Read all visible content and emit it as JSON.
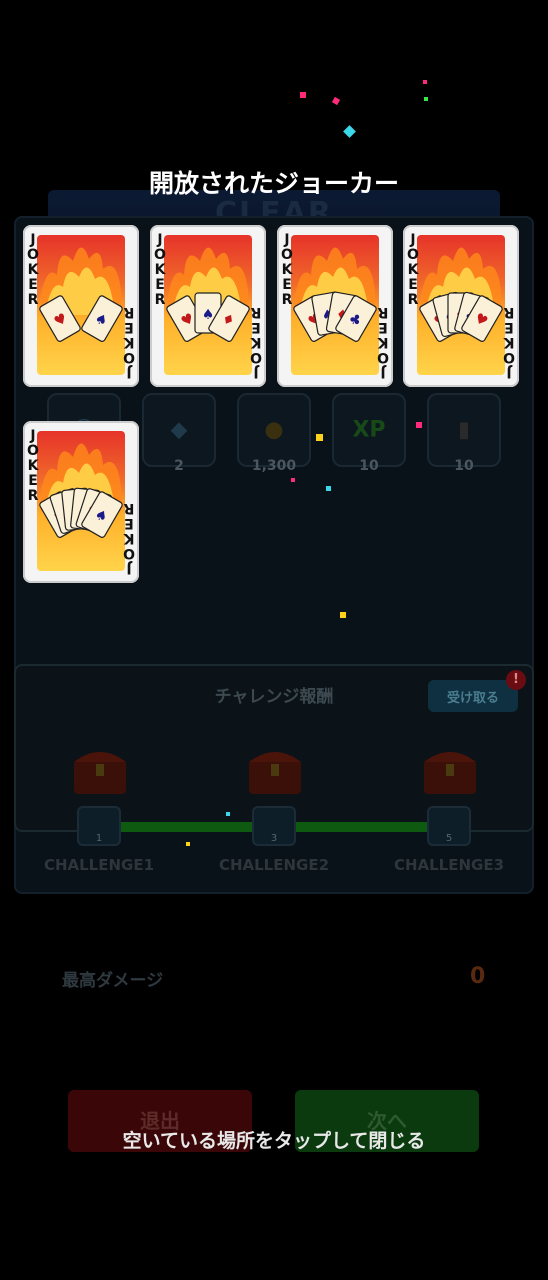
{
  "overlay": {
    "title": "開放されたジョーカー",
    "close_hint": "空いている場所をタップして閉じる"
  },
  "background": {
    "clear_banner": "CLEAR",
    "rewards": [
      {
        "icon": "character-icon",
        "value": ""
      },
      {
        "icon": "ticket-icon",
        "value": "2"
      },
      {
        "icon": "coin-icon",
        "value": "1,300"
      },
      {
        "icon": "xp-icon",
        "value": "10"
      },
      {
        "icon": "card-icon",
        "value": "10"
      }
    ],
    "xp_text": "XP",
    "challenge": {
      "title": "チャレンジ報酬",
      "receive_button": "受け取る",
      "alert": "!",
      "tickets": [
        "1",
        "3",
        "5"
      ],
      "labels": [
        "CHALLENGE1",
        "CHALLENGE2",
        "CHALLENGE3"
      ]
    },
    "max_damage_label": "最高ダメージ",
    "max_damage_value": "0",
    "exit_button": "退出",
    "next_button": "次へ"
  },
  "jokers": [
    {
      "label": "JOKER",
      "cards_in_hand": 2
    },
    {
      "label": "JOKER",
      "cards_in_hand": 3
    },
    {
      "label": "JOKER",
      "cards_in_hand": 4
    },
    {
      "label": "JOKER",
      "cards_in_hand": 5
    },
    {
      "label": "JOKER",
      "cards_in_hand": 6
    }
  ],
  "colors": {
    "accent_red": "#e6332a",
    "accent_orange": "#ffb02a",
    "confetti": [
      "#ff2a7a",
      "#3ad8e8",
      "#ffd21a",
      "#3ae84a"
    ]
  }
}
